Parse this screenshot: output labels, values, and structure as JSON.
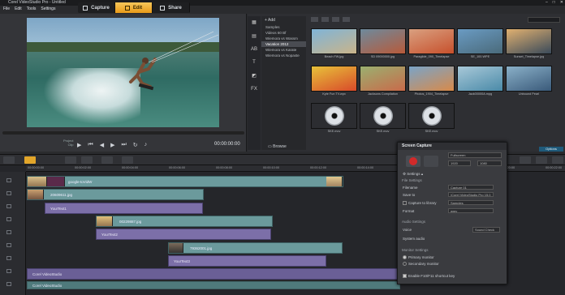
{
  "window": {
    "title": "Corel VideoStudio Pro - Untitled",
    "controls": [
      "–",
      "□",
      "✕"
    ]
  },
  "menu": [
    "File",
    "Edit",
    "Tools",
    "Settings"
  ],
  "steps": [
    {
      "label": "Capture"
    },
    {
      "label": "Edit"
    },
    {
      "label": "Share"
    }
  ],
  "preview": {
    "mode_labels": [
      "Project",
      "Clip"
    ],
    "timecode": "00:00:00:00"
  },
  "library": {
    "add_label": "Add",
    "folders": [
      "Samples",
      "Videos 60 Bf",
      "Wiemora vs Wassm",
      "Vacation 2012",
      "Wiemora vs Karate",
      "Wiemora vs Nopaste"
    ],
    "selected_folder": 3,
    "browse_label": "Browse",
    "options_label": "Options",
    "thumbs": [
      {
        "caption": "Beach FW.jpg",
        "c1": "#7fb4d8",
        "c2": "#c9b48a"
      },
      {
        "caption": "SD 09000000.jpg",
        "c1": "#6d8a9d",
        "c2": "#b75a3a"
      },
      {
        "caption": "Paraglide_090_Timelapse",
        "c1": "#d9a080",
        "c2": "#c7502c"
      },
      {
        "caption": "SE_100.WPE",
        "c1": "#6a9bc3",
        "c2": "#4a6a7a"
      },
      {
        "caption": "Sunset_Timelapse.jpg",
        "c1": "#e0b070",
        "c2": "#3a4a5a"
      },
      {
        "caption": "Kyte Fun TV.wpx",
        "c1": "#e8c23a",
        "c2": "#d84a2a"
      },
      {
        "caption": "Jacksons Compilation",
        "c1": "#9ab070",
        "c2": "#c96a4a"
      },
      {
        "caption": "Photos_1904_Timelapse",
        "c1": "#7aa4c8",
        "c2": "#d88a4a"
      },
      {
        "caption": "Jack00000A.mpg",
        "c1": "#a8c8d8",
        "c2": "#4a8aa8"
      },
      {
        "caption": "Unbound Pearl",
        "c1": "#8ab0c8",
        "c2": "#3a5a7a"
      },
      {
        "caption": "SKE.mov",
        "disc": true
      },
      {
        "caption": "SKE.mov",
        "disc": true
      },
      {
        "caption": "SKE.mov",
        "disc": true
      }
    ]
  },
  "timeline": {
    "ruler": [
      "00:00:00:00",
      "00:00:02:00",
      "00:00:04:00",
      "00:00:06:00",
      "00:00:08:00",
      "00:00:10:00",
      "00:00:12:00",
      "00:00:14:00",
      "00:00:16:00",
      "00:00:18:00",
      "00:00:20:00",
      "00:00:22:00"
    ],
    "clips": {
      "c0": "google-toVidW",
      "c1": "20609611.jpg",
      "c2": "YourText1",
      "c3": "00229887.jpg",
      "c4": "YourText2",
      "c5": "79362001.jpg",
      "c6": "YourText3",
      "c7": "Corel VideoStudio",
      "c8": "Corel VideoStudio"
    }
  },
  "screen_capture": {
    "title": "Screen Capture",
    "fullscreen": "Fullscreen",
    "w": "1920",
    "h": "1080",
    "settings": "Settings",
    "file_settings": "File Settings",
    "filename_label": "Filename",
    "filename": "Capture 01",
    "saveto_label": "Save to",
    "saveto": "\\Corel VideoStudio Pro 15.0",
    "capture_to_library": "Capture to library",
    "library_value": "Samples",
    "format_label": "Format",
    "format_value": "wmv",
    "audio_settings": "Audio Settings",
    "voice_label": "Voice",
    "sound_check": "Sound Check",
    "system_audio_label": "System audio",
    "monitor_settings": "Monitor Settings",
    "primary": "Primary monitor",
    "secondary": "Secondary monitor",
    "enable_f10": "Enable F10/F11 shortcut key"
  }
}
